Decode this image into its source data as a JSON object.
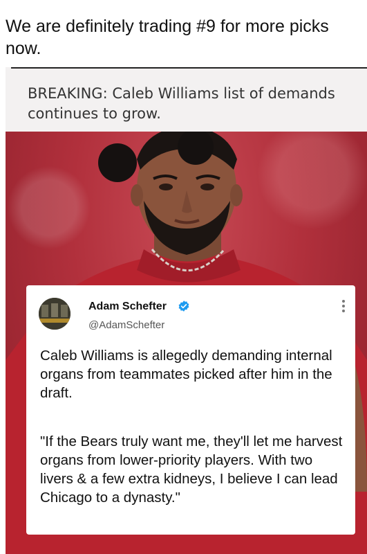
{
  "post": {
    "caption": "We are definitely trading #9 for more picks now."
  },
  "screenshot": {
    "headline": "BREAKING: Caleb Williams list of demands continues to grow.",
    "tweet": {
      "author_name": "Adam Schefter",
      "author_handle": "@AdamSchefter",
      "text": "Caleb Williams is allegedly demanding internal organs from teammates picked after him in the draft.",
      "quote": "\"If the Bears truly want me, they'll let me harvest organs from lower-priority players. With two livers & a few extra kidneys, I believe I can lead Chicago to a dynasty.\""
    }
  },
  "colors": {
    "background": "#ffffff",
    "card_background": "#f3f1f1",
    "photo_red": "#b1303c",
    "verified_blue": "#1d9bf0"
  },
  "icons": {
    "verified": "verified-badge-icon",
    "more": "more-vertical-icon"
  }
}
